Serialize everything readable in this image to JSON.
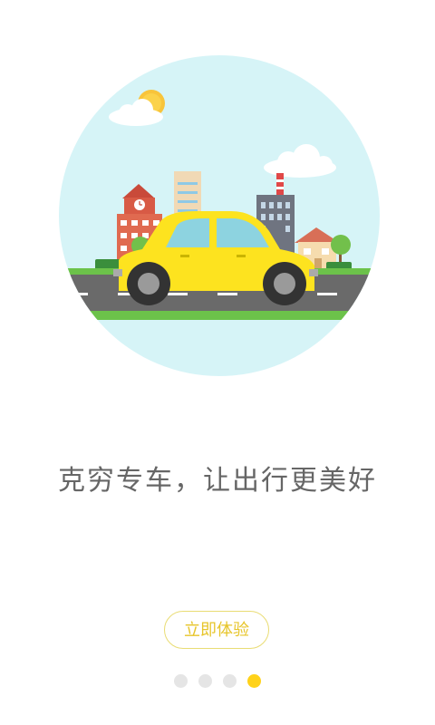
{
  "illustration": {
    "icon": "city-car-illustration",
    "colors": {
      "sky": "#d6f4f7",
      "car": "#fde31f",
      "road": "#6a6a6a",
      "grass": "#6cc24a"
    }
  },
  "slogan": "克穷专车，让出行更美好",
  "cta": {
    "label": "立即体验",
    "color": "#e7c52a"
  },
  "pagination": {
    "total": 4,
    "active_index": 3,
    "active_color": "#ffd21a",
    "inactive_color": "#e5e5e5"
  }
}
